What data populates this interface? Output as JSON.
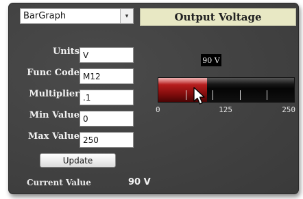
{
  "chart_type_select": {
    "selected": "BarGraph",
    "arrow": "▾"
  },
  "display": {
    "title": "Output Voltage",
    "value_badge": "90 V"
  },
  "form": {
    "units": {
      "label": "Units",
      "value": "V"
    },
    "func_code": {
      "label": "Func Code",
      "value": "M12"
    },
    "multiplier": {
      "label": "Multiplier",
      "value": ".1"
    },
    "min_value": {
      "label": "Min Value",
      "value": "0"
    },
    "max_value": {
      "label": "Max Value",
      "value": "250"
    }
  },
  "update_button": {
    "label": "Update"
  },
  "current": {
    "label": "Current Value",
    "value": "90 V"
  },
  "bar_graph": {
    "min": 0,
    "max": 250,
    "value": 90,
    "scale_labels": [
      "0",
      "125",
      "250"
    ],
    "tick_values": [
      50,
      100,
      150,
      200
    ]
  },
  "colors": {
    "fill": "#b41c1c",
    "panel": "#3f3f3f",
    "title_bg": "#e8e8c4"
  }
}
